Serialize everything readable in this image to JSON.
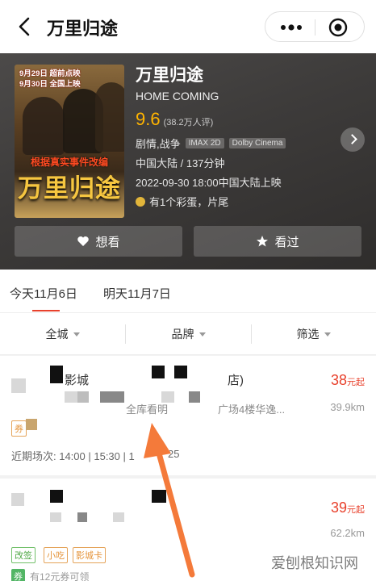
{
  "header": {
    "title": "万里归途"
  },
  "movie": {
    "title": "万里归途",
    "en_title": "HOME COMING",
    "score": "9.6",
    "votes": "(38.2万人评)",
    "genre": "剧情,战争",
    "formats": [
      "IMAX 2D",
      "Dolby Cinema"
    ],
    "region_duration": "中国大陆 / 137分钟",
    "release": "2022-09-30 18:00中国大陆上映",
    "easter_egg": "有1个彩蛋，片尾",
    "poster": {
      "top_line1": "9月29日 超前点映",
      "top_line2": "9月30日 全国上映",
      "tagline": "根据真实事件改编",
      "big_title": "万里归途"
    }
  },
  "actions": {
    "want": "想看",
    "seen": "看过"
  },
  "dates": {
    "today": "今天11月6日",
    "tomorrow": "明天11月7日"
  },
  "filters": {
    "city": "全城",
    "brand": "品牌",
    "sort": "筛选"
  },
  "cinemas": [
    {
      "name_fragment": "影城",
      "name_tail": "店)",
      "address_fragment": "全库看明",
      "address_tail": "广场4楼华逸...",
      "price": "38",
      "price_suffix": "元起",
      "distance": "39.9km",
      "badge": "券",
      "showtimes": "近期场次: 14:00 | 15:30 | 1",
      "showtimes_tail": "25"
    },
    {
      "price": "39",
      "price_suffix": "元起",
      "distance": "62.2km",
      "badges": [
        "改签",
        "小吃",
        "影城卡"
      ],
      "coupon_badge": "券",
      "coupon_text": "有12元券可领"
    }
  ],
  "watermark": "爱刨根知识网",
  "colors": {
    "accent": "#e8412c",
    "score": "#ffb400",
    "arrow": "#f47a3a"
  }
}
